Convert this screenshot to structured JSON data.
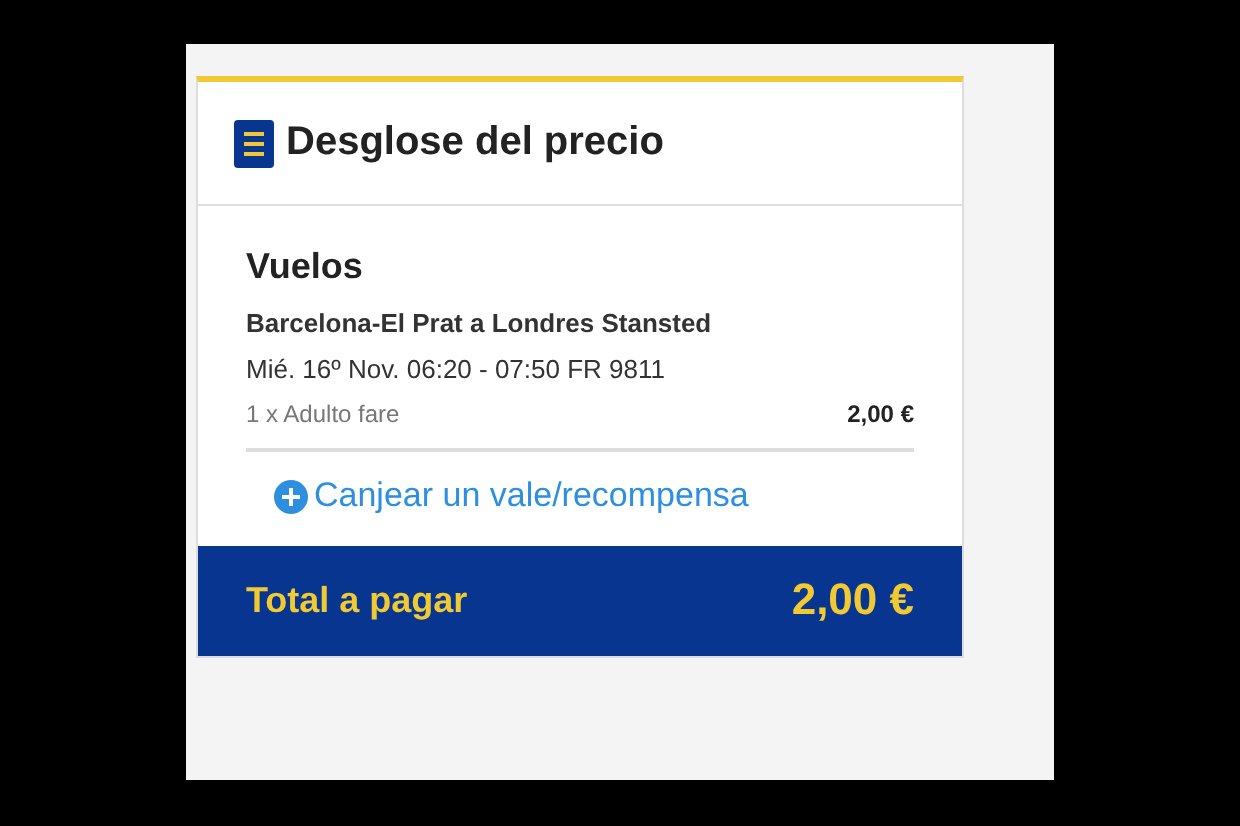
{
  "card": {
    "title": "Desglose del precio"
  },
  "section": {
    "heading": "Vuelos",
    "route": "Barcelona-El Prat a Londres Stansted",
    "schedule": "Mié. 16º Nov. 06:20 - 07:50 FR 9811",
    "fare": {
      "label": "1 x Adulto fare",
      "price": "2,00 €"
    }
  },
  "voucher_link": "Canjear un vale/recompensa",
  "total": {
    "label": "Total a pagar",
    "amount": "2,00 €"
  }
}
